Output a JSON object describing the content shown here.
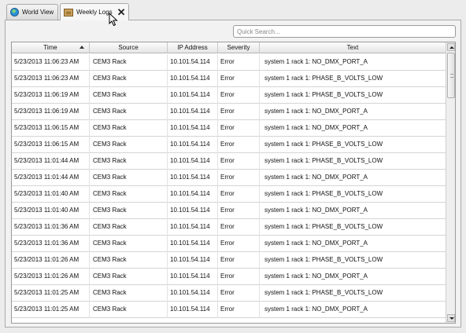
{
  "tabs": [
    {
      "label": "World View",
      "icon": "globe-icon",
      "active": false
    },
    {
      "label": "Weekly Logs",
      "icon": "log-book-icon",
      "active": true,
      "close": "✕"
    }
  ],
  "search": {
    "placeholder": "Quick Search...",
    "value": ""
  },
  "table": {
    "columns": [
      "Time",
      "Source",
      "IP Address",
      "Severity",
      "Text"
    ],
    "sort": {
      "column": "Time",
      "direction": "ascending"
    },
    "rows": [
      [
        "5/23/2013 11:06:23 AM",
        "CEM3 Rack",
        "10.101.54.114",
        "Error",
        "system 1 rack 1: NO_DMX_PORT_A"
      ],
      [
        "5/23/2013 11:06:23 AM",
        "CEM3 Rack",
        "10.101.54.114",
        "Error",
        "system 1 rack 1: PHASE_B_VOLTS_LOW"
      ],
      [
        "5/23/2013 11:06:19 AM",
        "CEM3 Rack",
        "10.101.54.114",
        "Error",
        "system 1 rack 1: PHASE_B_VOLTS_LOW"
      ],
      [
        "5/23/2013 11:06:19 AM",
        "CEM3 Rack",
        "10.101.54.114",
        "Error",
        "system 1 rack 1: NO_DMX_PORT_A"
      ],
      [
        "5/23/2013 11:06:15 AM",
        "CEM3 Rack",
        "10.101.54.114",
        "Error",
        "system 1 rack 1: NO_DMX_PORT_A"
      ],
      [
        "5/23/2013 11:06:15 AM",
        "CEM3 Rack",
        "10.101.54.114",
        "Error",
        "system 1 rack 1: PHASE_B_VOLTS_LOW"
      ],
      [
        "5/23/2013 11:01:44 AM",
        "CEM3 Rack",
        "10.101.54.114",
        "Error",
        "system 1 rack 1: PHASE_B_VOLTS_LOW"
      ],
      [
        "5/23/2013 11:01:44 AM",
        "CEM3 Rack",
        "10.101.54.114",
        "Error",
        "system 1 rack 1: NO_DMX_PORT_A"
      ],
      [
        "5/23/2013 11:01:40 AM",
        "CEM3 Rack",
        "10.101.54.114",
        "Error",
        "system 1 rack 1: PHASE_B_VOLTS_LOW"
      ],
      [
        "5/23/2013 11:01:40 AM",
        "CEM3 Rack",
        "10.101.54.114",
        "Error",
        "system 1 rack 1: NO_DMX_PORT_A"
      ],
      [
        "5/23/2013 11:01:36 AM",
        "CEM3 Rack",
        "10.101.54.114",
        "Error",
        "system 1 rack 1: PHASE_B_VOLTS_LOW"
      ],
      [
        "5/23/2013 11:01:36 AM",
        "CEM3 Rack",
        "10.101.54.114",
        "Error",
        "system 1 rack 1: NO_DMX_PORT_A"
      ],
      [
        "5/23/2013 11:01:26 AM",
        "CEM3 Rack",
        "10.101.54.114",
        "Error",
        "system 1 rack 1: PHASE_B_VOLTS_LOW"
      ],
      [
        "5/23/2013 11:01:26 AM",
        "CEM3 Rack",
        "10.101.54.114",
        "Error",
        "system 1 rack 1: NO_DMX_PORT_A"
      ],
      [
        "5/23/2013 11:01:25 AM",
        "CEM3 Rack",
        "10.101.54.114",
        "Error",
        "system 1 rack 1: PHASE_B_VOLTS_LOW"
      ],
      [
        "5/23/2013 11:01:25 AM",
        "CEM3 Rack",
        "10.101.54.114",
        "Error",
        "system 1 rack 1: NO_DMX_PORT_A"
      ]
    ]
  }
}
